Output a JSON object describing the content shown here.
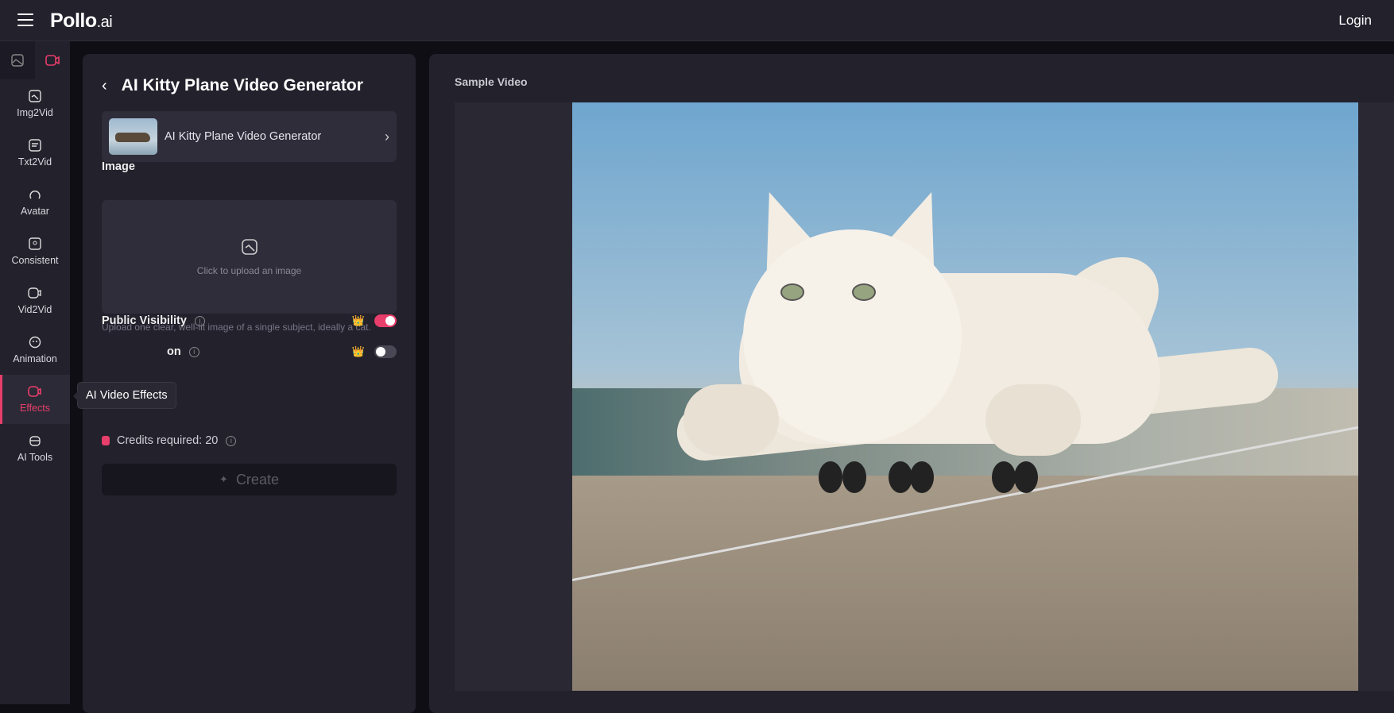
{
  "header": {
    "logo_main": "Pollo",
    "logo_suffix": ".ai",
    "login": "Login"
  },
  "sidebar": {
    "items": [
      {
        "label": "Img2Vid"
      },
      {
        "label": "Txt2Vid"
      },
      {
        "label": "Avatar"
      },
      {
        "label": "Consistent"
      },
      {
        "label": "Vid2Vid"
      },
      {
        "label": "Animation"
      },
      {
        "label": "Effects",
        "active": true
      },
      {
        "label": "AI Tools"
      }
    ],
    "tooltip": "AI Video Effects"
  },
  "panel": {
    "title": "AI Kitty Plane Video Generator",
    "template_card": "AI Kitty Plane Video Generator",
    "image_label": "Image",
    "upload_text": "Click to upload an image",
    "hint": "Upload one clear, well-lit image of a single subject, ideally a cat.",
    "public_visibility": "Public Visibility",
    "public_visibility_on": true,
    "second_option_visible": "on",
    "second_option_on": false,
    "credits": "Credits required: 20",
    "create": "Create"
  },
  "preview": {
    "label": "Sample Video"
  },
  "colors": {
    "accent": "#e83e6b",
    "bg": "#23212c"
  }
}
